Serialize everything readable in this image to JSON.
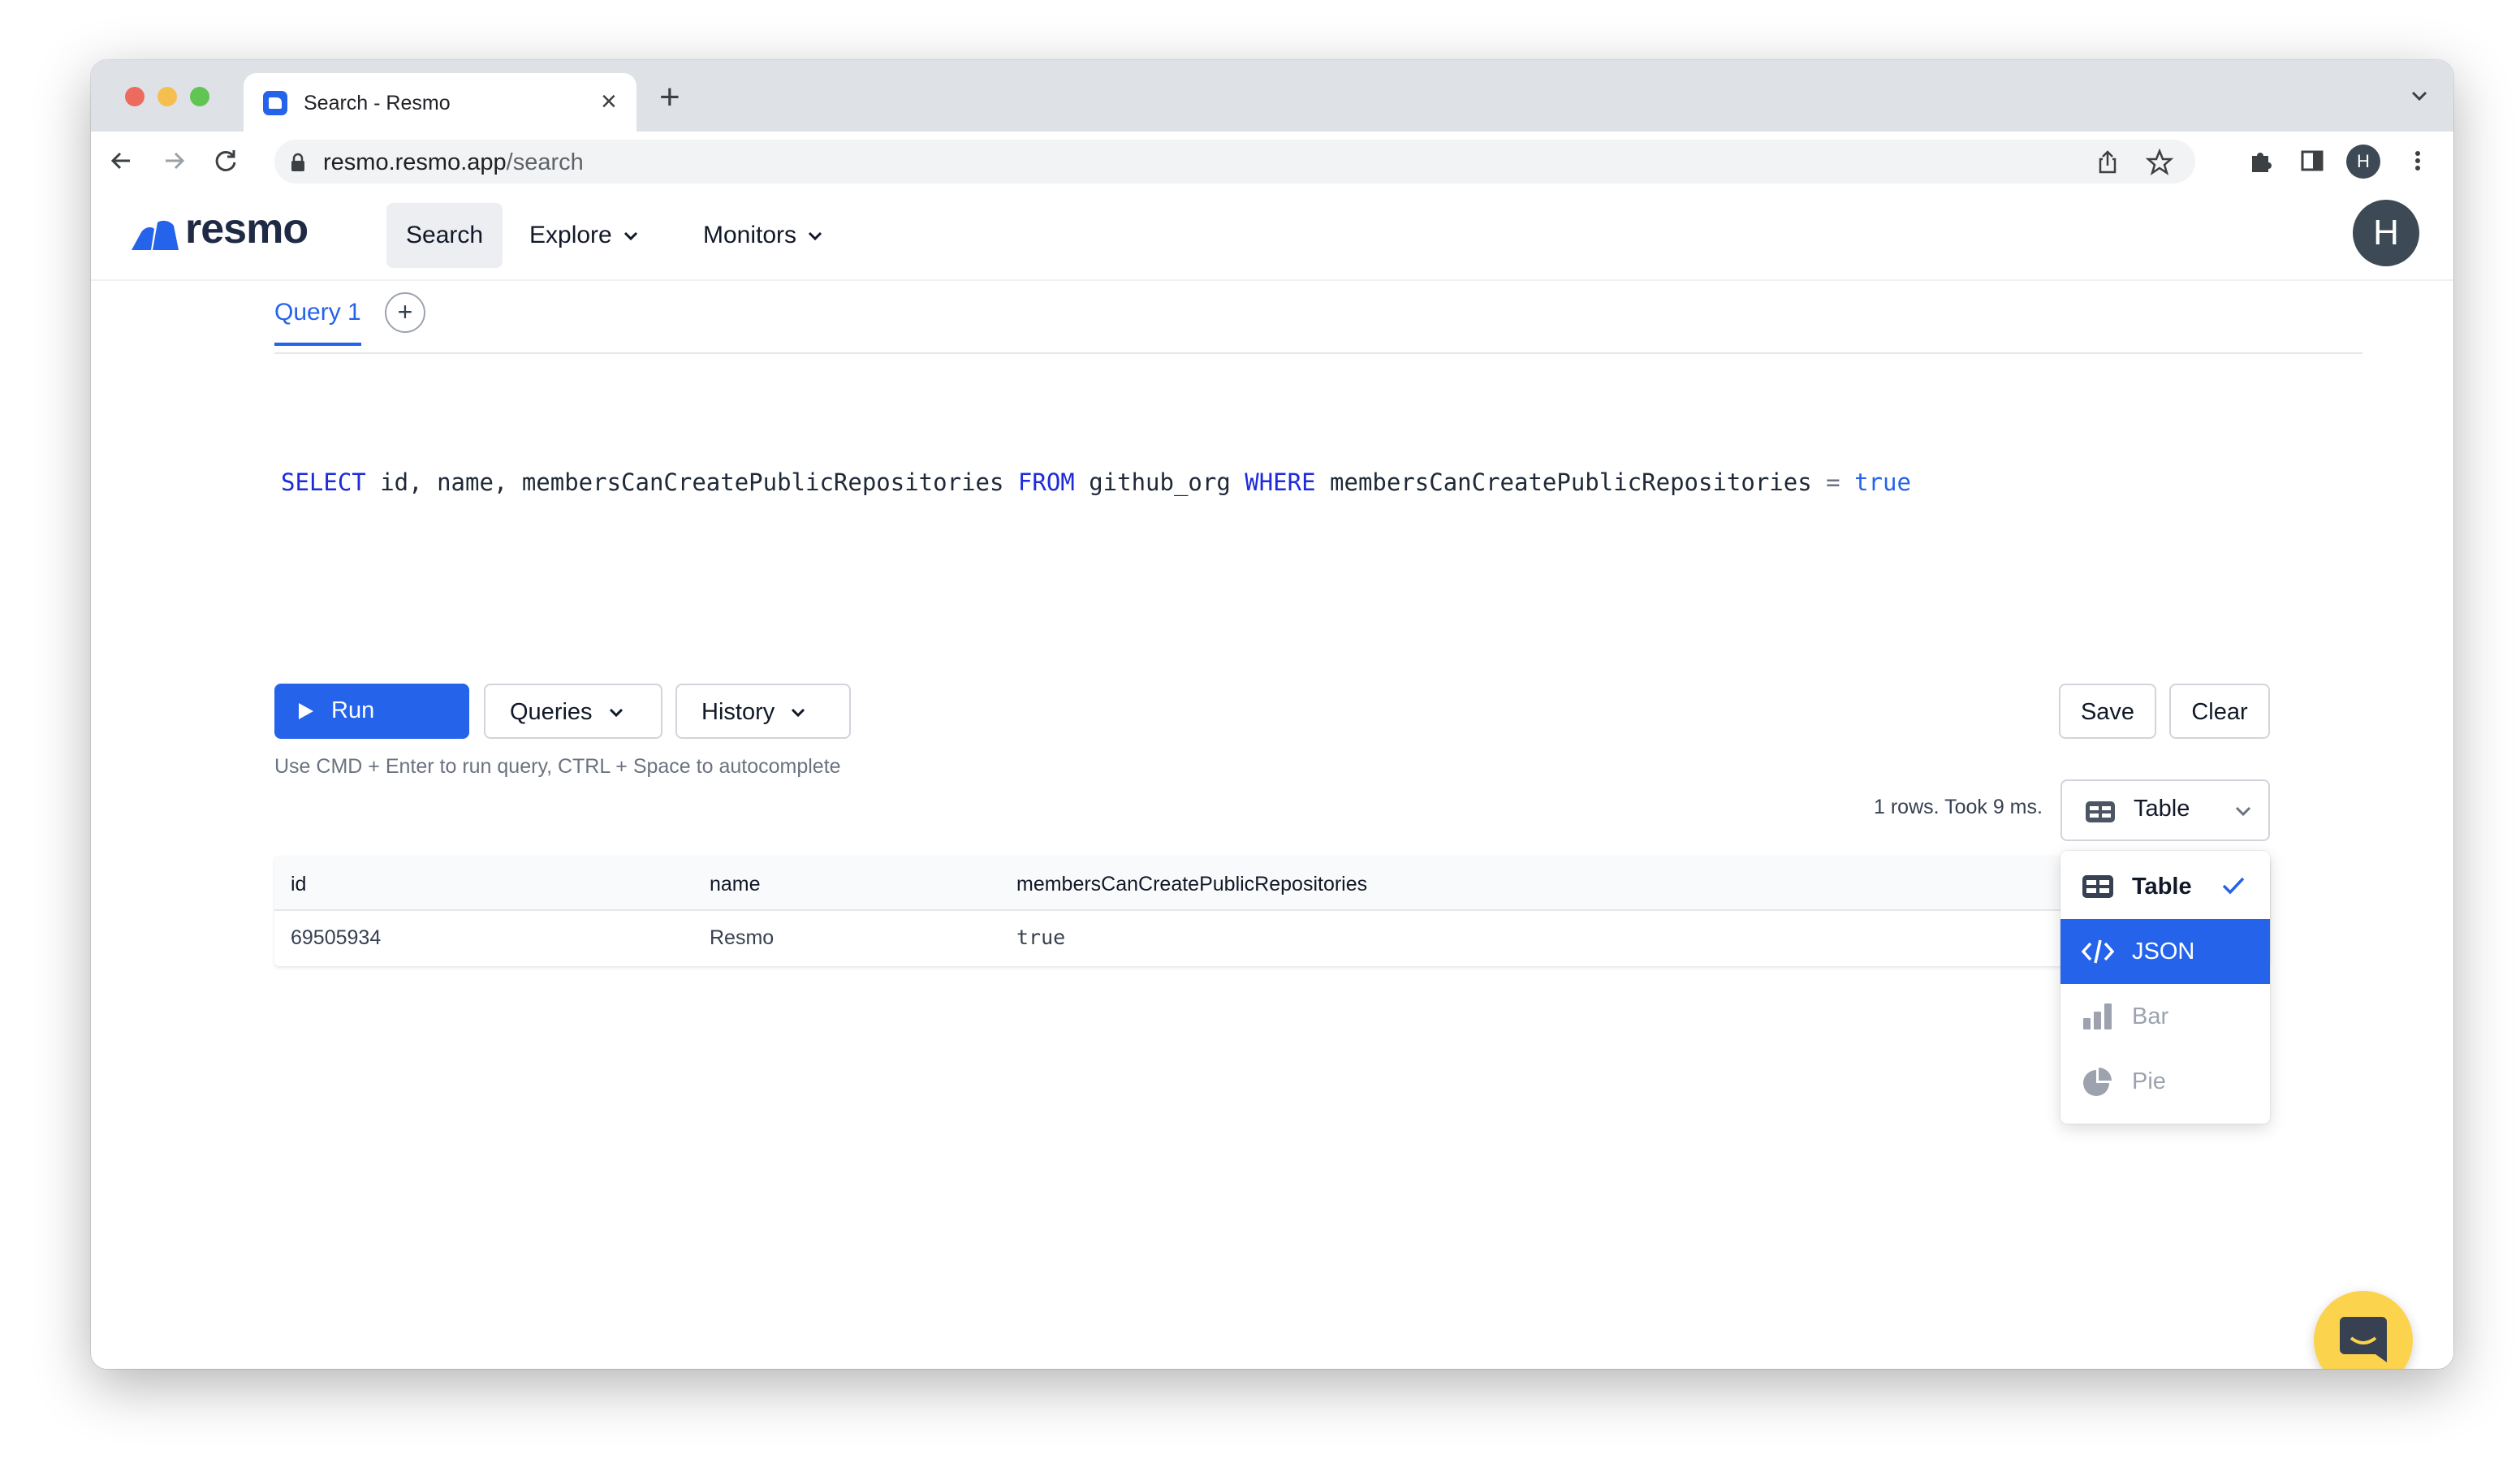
{
  "browser": {
    "tab_title": "Search - Resmo",
    "close_glyph": "×",
    "new_tab_glyph": "+",
    "url_host": "resmo.resmo.app",
    "url_path": "/search",
    "profile_initial": "H"
  },
  "header": {
    "logo_text": "resmo",
    "nav": {
      "search": "Search",
      "explore": "Explore",
      "monitors": "Monitors"
    },
    "avatar_initial": "H"
  },
  "query_tabs": {
    "active": "Query 1",
    "add_glyph": "+"
  },
  "editor": {
    "select_kw": "SELECT",
    "columns": " id, name, membersCanCreatePublicRepositories ",
    "from_kw": "FROM",
    "table": " github_org ",
    "where_kw": "WHERE",
    "condition": " membersCanCreatePublicRepositories ",
    "operator": "=",
    "value": "true"
  },
  "actions": {
    "run": "Run Query",
    "queries": "Queries",
    "history": "History",
    "save": "Save",
    "clear": "Clear",
    "hint": "Use CMD + Enter to run query, CTRL + Space to autocomplete"
  },
  "results": {
    "stats": "1 rows. Took 9 ms.",
    "view_selected": "Table",
    "columns": [
      "id",
      "name",
      "membersCanCreatePublicRepositories"
    ],
    "rows": [
      [
        "69505934",
        "Resmo",
        "true"
      ]
    ]
  },
  "view_menu": {
    "items": [
      "Table",
      "JSON",
      "Bar",
      "Pie"
    ],
    "checked": "Table",
    "highlighted": "JSON"
  },
  "colors": {
    "accent": "#2563eb",
    "chat_button": "#fcd34d"
  }
}
